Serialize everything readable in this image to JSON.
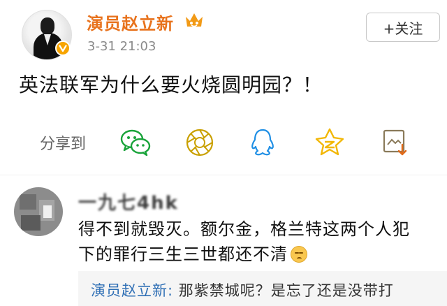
{
  "post": {
    "author": "演员赵立新",
    "timestamp": "3-31 21:03",
    "follow_label": "+关注",
    "text": "英法联军为什么要火烧圆明园？！"
  },
  "share": {
    "label": "分享到",
    "targets": [
      "wechat-icon",
      "moments-icon",
      "qq-icon",
      "qzone-icon",
      "save-image-icon"
    ]
  },
  "comment": {
    "author": "一九七4hk",
    "text_line1": "得不到就毁灭。额尔金，格兰特这两个人犯",
    "text_line2": "下的罪行三生三世都还不清",
    "reply": {
      "author": "演员赵立新:",
      "text": " 那紫禁城呢？是忘了还是没带打"
    }
  },
  "colors": {
    "author_orange": "#e8731e",
    "reply_blue": "#2f6fb5",
    "verified_badge": "#f7a400"
  }
}
